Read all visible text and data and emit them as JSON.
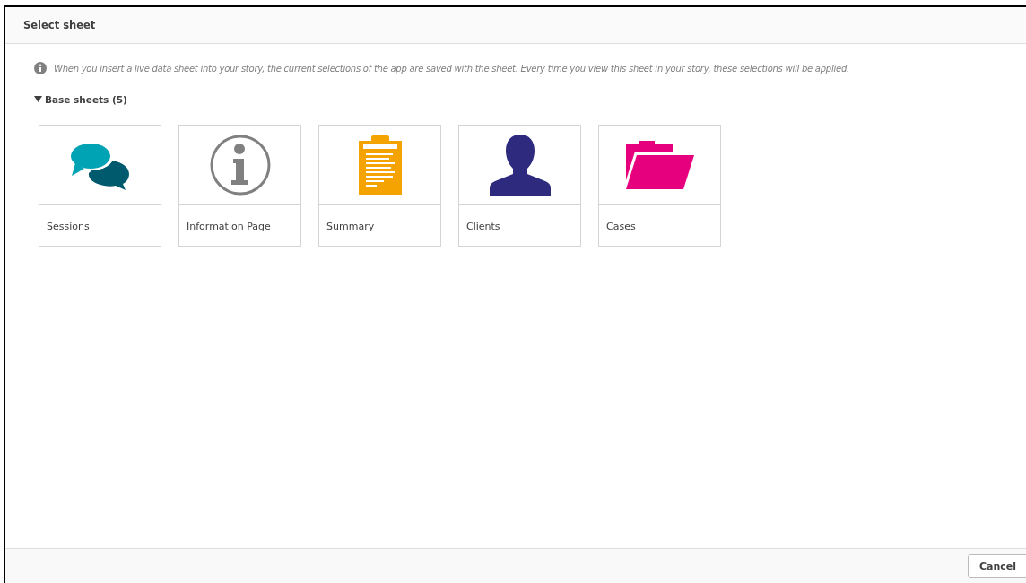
{
  "dialog": {
    "title": "Select sheet"
  },
  "info_text": "When you insert a live data sheet into your story, the current selections of the app are saved with the sheet. Every time you view this sheet in your story, these selections will be applied.",
  "section": {
    "label": "Base sheets (5)",
    "expanded": true
  },
  "sheets": [
    {
      "title": "Sessions",
      "kind": "chat"
    },
    {
      "title": "Information Page",
      "kind": "info"
    },
    {
      "title": "Summary",
      "kind": "clipboard"
    },
    {
      "title": "Clients",
      "kind": "person"
    },
    {
      "title": "Cases",
      "kind": "folder"
    }
  ],
  "buttons": [
    {
      "label": "Cancel"
    }
  ]
}
